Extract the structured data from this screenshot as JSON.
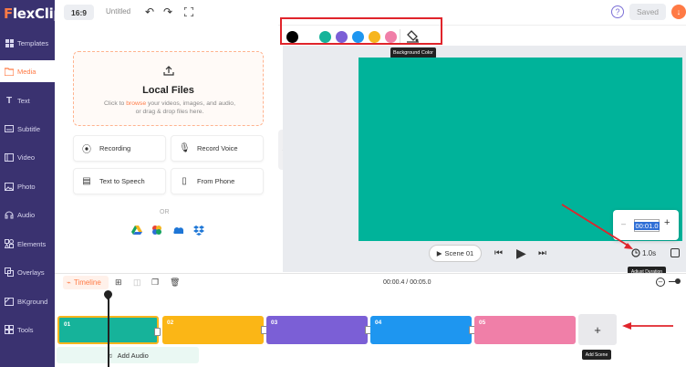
{
  "app": {
    "logo_prefix": "F",
    "logo_rest": "lexClip"
  },
  "sidebar": {
    "items": [
      {
        "label": "Templates",
        "icon": "grid-icon"
      },
      {
        "label": "Media",
        "icon": "folder-icon"
      },
      {
        "label": "Text",
        "icon": "text-icon"
      },
      {
        "label": "Subtitle",
        "icon": "subtitle-icon"
      },
      {
        "label": "Video",
        "icon": "video-icon"
      },
      {
        "label": "Photo",
        "icon": "photo-icon"
      },
      {
        "label": "Audio",
        "icon": "audio-icon"
      },
      {
        "label": "Elements",
        "icon": "elements-icon"
      },
      {
        "label": "Overlays",
        "icon": "overlays-icon"
      },
      {
        "label": "BKground",
        "icon": "background-icon"
      },
      {
        "label": "Tools",
        "icon": "tools-icon"
      }
    ],
    "active": "Media"
  },
  "topbar": {
    "ratio": "16:9",
    "title": "Untitled",
    "saved": "Saved",
    "help": "?",
    "avatar": "↓"
  },
  "media": {
    "upload_title": "Local Files",
    "upload_sub_pre": "Click to ",
    "upload_sub_link": "browse",
    "upload_sub_post": " your videos, images, and audio, or drag & drop files here.",
    "tiles": [
      "Recording",
      "Record Voice",
      "Text to Speech",
      "From Phone"
    ],
    "or": "OR"
  },
  "colorbar": {
    "swatches": [
      "#000000",
      "#ffffff",
      "#16b39a",
      "#7b5fd6",
      "#1e96f0",
      "#f6b51e",
      "#f07fa8"
    ],
    "tooltip": "Background Color"
  },
  "canvas": {
    "color": "#00b39a"
  },
  "player": {
    "scene": "Scene 01"
  },
  "duration": {
    "value": "00:01.0",
    "button": "1.0s",
    "tooltip": "Adjust Duration"
  },
  "timeline": {
    "label": "Timeline",
    "time": "00:00.4 / 00:05.0",
    "clips": [
      {
        "label": "01",
        "color": "#16b39a"
      },
      {
        "label": "02",
        "color": "#fbb616"
      },
      {
        "label": "03",
        "color": "#7b5fd6"
      },
      {
        "label": "04",
        "color": "#1e96f0"
      },
      {
        "label": "05",
        "color": "#f07fa8"
      }
    ],
    "add_scene": "+",
    "add_scene_tip": "Add Scene",
    "add_audio": "Add Audio"
  }
}
